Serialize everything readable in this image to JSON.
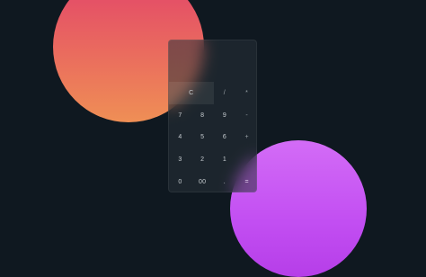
{
  "calculator": {
    "display_value": "",
    "rows": [
      [
        {
          "label": "C",
          "name": "clear-button",
          "kind": "clear"
        },
        {
          "label": "/",
          "name": "divide-button",
          "kind": "op"
        },
        {
          "label": "*",
          "name": "multiply-button",
          "kind": "op"
        }
      ],
      [
        {
          "label": "7",
          "name": "digit-7-button",
          "kind": "num"
        },
        {
          "label": "8",
          "name": "digit-8-button",
          "kind": "num"
        },
        {
          "label": "9",
          "name": "digit-9-button",
          "kind": "num"
        },
        {
          "label": "-",
          "name": "subtract-button",
          "kind": "op"
        }
      ],
      [
        {
          "label": "4",
          "name": "digit-4-button",
          "kind": "num"
        },
        {
          "label": "5",
          "name": "digit-5-button",
          "kind": "num"
        },
        {
          "label": "6",
          "name": "digit-6-button",
          "kind": "num"
        },
        {
          "label": "+",
          "name": "add-button",
          "kind": "op"
        }
      ],
      [
        {
          "label": "3",
          "name": "digit-3-button",
          "kind": "num"
        },
        {
          "label": "2",
          "name": "digit-2-button",
          "kind": "num"
        },
        {
          "label": "1",
          "name": "digit-1-button",
          "kind": "num"
        },
        {
          "label": "",
          "name": "empty-key",
          "kind": "num"
        }
      ],
      [
        {
          "label": "0",
          "name": "digit-0-button",
          "kind": "num"
        },
        {
          "label": "00",
          "name": "double-zero-button",
          "kind": "num"
        },
        {
          "label": ".",
          "name": "decimal-button",
          "kind": "num"
        },
        {
          "label": "=",
          "name": "equals-button",
          "kind": "eq"
        }
      ]
    ]
  },
  "colors": {
    "background": "#0f1820",
    "orange_blob_top": "#e2436a",
    "orange_blob_bottom": "#ef8f55",
    "purple_blob_top": "#d36cf6",
    "purple_blob_bottom": "#b63ee8"
  }
}
